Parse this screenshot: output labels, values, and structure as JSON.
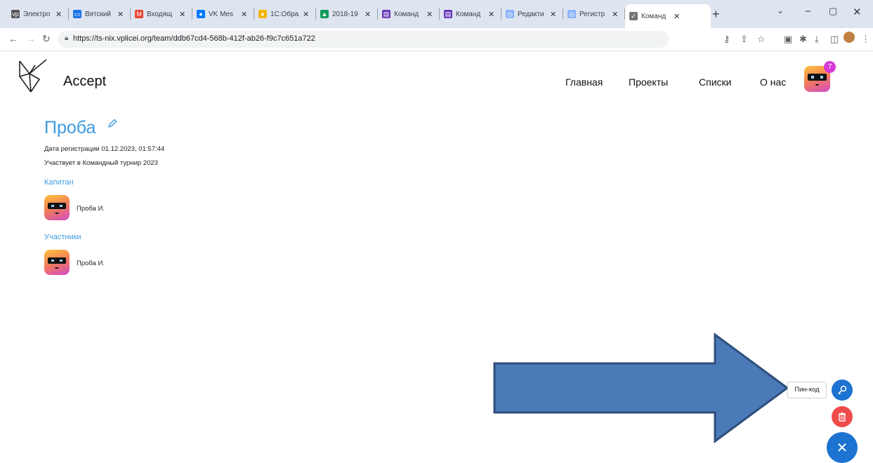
{
  "browser": {
    "tabs": [
      {
        "title": "Электро",
        "fav": "vp",
        "favcolor": "#555555"
      },
      {
        "title": "Вятский",
        "fav": "▭",
        "favcolor": "#1a73e8"
      },
      {
        "title": "Входящ",
        "fav": "M",
        "favcolor": "#ea4335"
      },
      {
        "title": "VK Mes",
        "fav": "●",
        "favcolor": "#0077ff"
      },
      {
        "title": "1С:Обра",
        "fav": "●",
        "favcolor": "#f4b400"
      },
      {
        "title": "2018-19",
        "fav": "▲",
        "favcolor": "#0f9d58"
      },
      {
        "title": "Команд",
        "fav": "▤",
        "favcolor": "#673ab7"
      },
      {
        "title": "Команд",
        "fav": "▤",
        "favcolor": "#673ab7"
      },
      {
        "title": "Редакти",
        "fav": "◎",
        "favcolor": "#8ab4f8"
      },
      {
        "title": "Регистр",
        "fav": "◎",
        "favcolor": "#8ab4f8"
      },
      {
        "title": "Команд",
        "fav": "✓",
        "favcolor": "#777777",
        "active": true
      }
    ],
    "url": "https://ts-nix.vplicei.org/team/ddb67cd4-568b-412f-ab26-f9c7c651a722"
  },
  "site": {
    "brand": "Accept",
    "menu": [
      "Главная",
      "Проекты",
      "Списки",
      "О нас"
    ],
    "notification_count": "7"
  },
  "team": {
    "name": "Проба",
    "registered": "Дата регистрации 01.12.2023, 01:57:44",
    "participates": "Участвует в Командный турнир 2023",
    "captain_heading": "Капитан",
    "captain_name": "Проба И.",
    "members_heading": "Участники",
    "member_name": "Проба И."
  },
  "actions": {
    "pin_tooltip": "Пин-код"
  },
  "colors": {
    "accent": "#3d9ae0",
    "fab_blue": "#1d73d1",
    "fab_red": "#ef4b4b",
    "arrow_fill": "#4a7ab8",
    "arrow_stroke": "#2d4f7c"
  }
}
